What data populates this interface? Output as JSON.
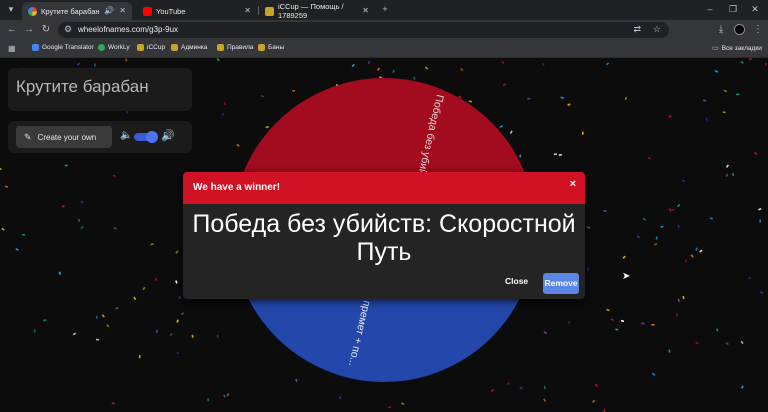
{
  "browser": {
    "tabs": [
      {
        "label": "Крутите барабан",
        "active": true
      },
      {
        "label": "YouTube",
        "active": false
      },
      {
        "label": "iCCup — Помощь / 1789259",
        "active": false
      }
    ],
    "new_tab_icon": "plus-icon",
    "url": "wheelofnames.com/g3p-9ux",
    "bookmarks": [
      "Google Translator",
      "WorkLy",
      "iCCup",
      "Админка",
      "Правила",
      "Баны"
    ],
    "all_bookmarks": "Все закладки"
  },
  "app": {
    "title": "Крутите барабан",
    "create_button": "Create your own"
  },
  "wheel": {
    "visible_labels": [
      "Победа без убийст...",
      "премет + по..."
    ],
    "colors": [
      "#a30b1e",
      "#2347ab"
    ]
  },
  "dialog": {
    "header": "We have a winner!",
    "close_x": "×",
    "winner": "Победа без убийств: Скоростной Путь",
    "close_label": "Close",
    "remove_label": "Remove"
  }
}
